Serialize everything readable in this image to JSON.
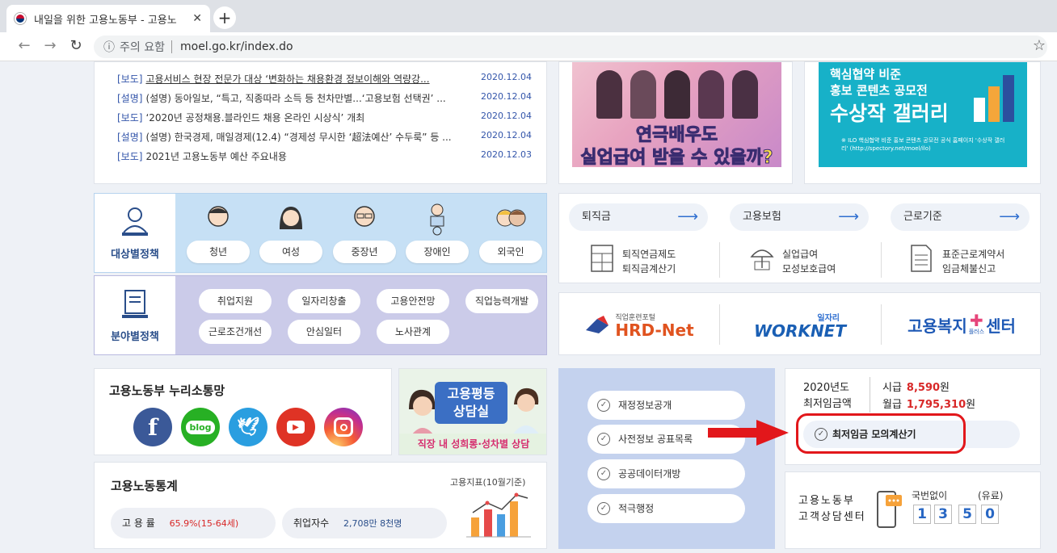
{
  "browser": {
    "tab_title": "내일을 위한 고용노동부 - 고용노",
    "warning": "주의 요함",
    "url": "moel.go.kr/index.do"
  },
  "news": [
    {
      "cat": "[보도]",
      "title": "고용서비스 현장 전문가 대상 ‘변화하는 채용환경 정보이해와 역량강...",
      "date": "2020.12.04"
    },
    {
      "cat": "[설명]",
      "title": "(설명) 동아일보, “특고, 직종따라 소득 등 천차만별...‘고용보험 선택권’ ...",
      "date": "2020.12.04"
    },
    {
      "cat": "[보도]",
      "title": "‘2020년 공정채용.블라인드 채용 온라인 시상식’ 개최",
      "date": "2020.12.04"
    },
    {
      "cat": "[설명]",
      "title": "(설명) 한국경제, 매일경제(12.4) “경제성 무시한 ‘超法예산’ 수두룩” 등 ...",
      "date": "2020.12.04"
    },
    {
      "cat": "[보도]",
      "title": "2021년 고용노동부 예산 주요내용",
      "date": "2020.12.03"
    }
  ],
  "banner1": {
    "line1": "연극배우도",
    "line2": "실업급여 받을 수 있을까?"
  },
  "banner2": {
    "line1": "핵심협약 비준",
    "line2": "홍보 콘텐츠 공모전",
    "line3": "수상작 갤러리",
    "note": "※ ILO 핵심협약 비준 홍보 콘텐츠 공모전 공식 홈페이지 '수상작 갤러리' (http://spectory.net/moel/ilo)"
  },
  "target_policy": {
    "label": "대상별정책",
    "items": [
      "청년",
      "여성",
      "중장년",
      "장애인",
      "외국인"
    ]
  },
  "field_policy": {
    "label": "분야별정책",
    "items": [
      "취업지원",
      "일자리창출",
      "고용안전망",
      "직업능력개발",
      "근로조건개선",
      "안심일터",
      "노사관계"
    ]
  },
  "quick_links": [
    {
      "title": "퇴직금",
      "sub1": "퇴직연금제도",
      "sub2": "퇴직금계산기"
    },
    {
      "title": "고용보험",
      "sub1": "실업급여",
      "sub2": "모성보호급여"
    },
    {
      "title": "근로기준",
      "sub1": "표준근로계약서",
      "sub2": "임금체불신고"
    }
  ],
  "portals": {
    "hrd_small": "직업훈련포털",
    "hrd": "HRD-Net",
    "worknet_small": "일자리",
    "worknet": "WORKNET",
    "welfare": "고용복지",
    "welfare_end": "센터",
    "welfare_small": "플러스"
  },
  "social": {
    "title": "고용노동부 누리소통망",
    "blog": "blog"
  },
  "equality_banner": {
    "line1": "고용평등",
    "line2": "상담실",
    "footer": "직장 내 성희롱·성차별 상담"
  },
  "stats": {
    "title": "고용노동통계",
    "subtitle": "고용지표(10월기준)",
    "employment_label": "고 용 률",
    "employment_value": "65.9%(15-64세)",
    "employed_label": "취업자수",
    "employed_value": "2,708만 8천명"
  },
  "public_info": [
    "재정정보공개",
    "사전정보 공표목록",
    "공공데이터개방",
    "적극행정"
  ],
  "min_wage": {
    "year": "2020년도",
    "label": "최저임금액",
    "hourly_label": "시급",
    "hourly_value": "8,590",
    "monthly_label": "월급",
    "monthly_value": "1,795,310",
    "unit": "원",
    "calc_label": "최저임금 모의계산기"
  },
  "counsel": {
    "line1": "고용노동부",
    "line2": "고객상담센터",
    "no_area": "국번없이",
    "paid": "(유료)",
    "digits": [
      "1",
      "3",
      "5",
      "0"
    ]
  },
  "colors": {
    "accent_red": "#e2171b",
    "brand_blue": "#2f6fd0"
  }
}
